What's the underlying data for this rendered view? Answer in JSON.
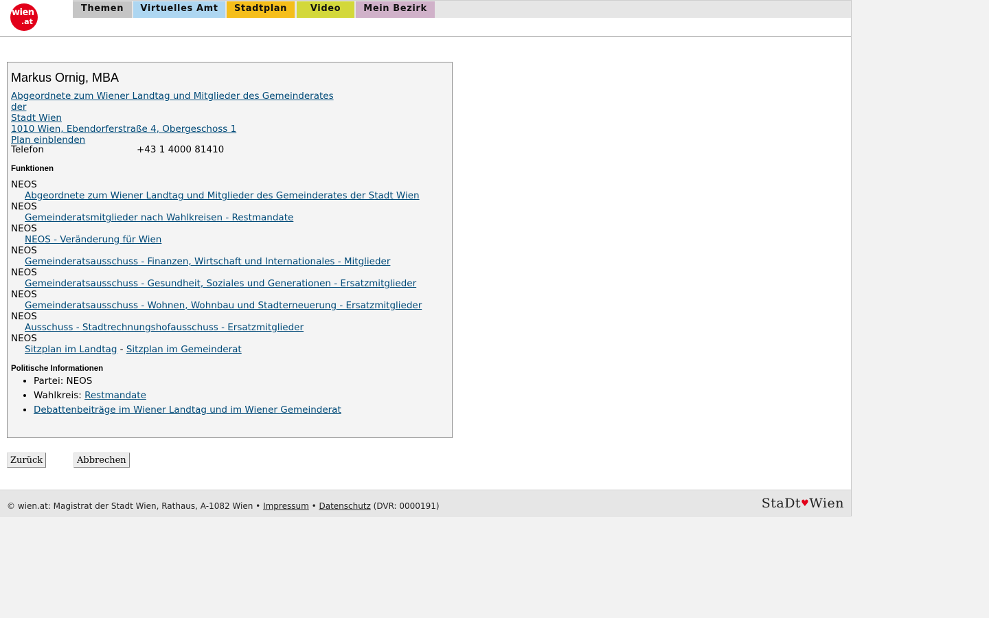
{
  "header": {
    "logo_top": "wien",
    "logo_bottom": ".at",
    "tabs": [
      {
        "label": "Themen"
      },
      {
        "label": "Virtuelles Amt"
      },
      {
        "label": "Stadtplan"
      },
      {
        "label": "Video"
      },
      {
        "label": "Mein Bezirk"
      }
    ]
  },
  "person": {
    "name": "Markus Ornig, MBA",
    "role_link_1": "Abgeordnete zum Wiener Landtag und Mitglieder des Gemeinderates der",
    "role_link_2": "Stadt Wien ",
    "address": "1010 Wien, Ebendorferstraße 4, Obergeschoss 1",
    "plan_link": "Plan einblenden",
    "tel_label": "Telefon",
    "tel_value": "+43 1 4000 81410"
  },
  "funktionen": {
    "title": "Funktionen",
    "items": [
      {
        "party": "NEOS",
        "link": "Abgeordnete zum Wiener Landtag und Mitglieder des Gemeinderates der Stadt Wien"
      },
      {
        "party": "NEOS",
        "link": "Gemeinderatsmitglieder nach Wahlkreisen - Restmandate"
      },
      {
        "party": "NEOS",
        "link": "NEOS - Veränderung für Wien"
      },
      {
        "party": "NEOS",
        "link": "Gemeinderatsausschuss - Finanzen, Wirtschaft und Internationales - Mitglieder"
      },
      {
        "party": "NEOS",
        "link": "Gemeinderatsausschuss - Gesundheit, Soziales und Generationen - Ersatzmitglieder"
      },
      {
        "party": "NEOS",
        "link": "Gemeinderatsausschuss - Wohnen, Wohnbau und Stadterneuerung - Ersatzmitglieder"
      },
      {
        "party": "NEOS",
        "link": "Ausschuss - Stadtrechnungshofausschuss - Ersatzmitglieder"
      }
    ],
    "last_party": "NEOS",
    "sitzplan_landtag": "Sitzplan im Landtag",
    "sitzplan_sep": " - ",
    "sitzplan_gemeinderat": "Sitzplan im Gemeinderat"
  },
  "politisch": {
    "title": "Politische Informationen",
    "partei_label": "Partei: NEOS",
    "wahlkreis_label": "Wahlkreis: ",
    "wahlkreis_link": "Restmandate",
    "debatten_link": "Debattenbeiträge im Wiener Landtag und im Wiener Gemeinderat"
  },
  "buttons": {
    "back": "Zurück",
    "cancel": "Abbrechen"
  },
  "footer": {
    "text_pre": "© wien.at: Magistrat der Stadt Wien, Rathaus, A-1082 Wien • ",
    "impressum": "Impressum",
    "sep": " • ",
    "datenschutz": "Datenschutz",
    "dvr": " (DVR: 0000191)",
    "brand_left": "StaDt",
    "brand_right": "Wien"
  },
  "colors": {
    "link": "#004a78",
    "logo_red": "#e2001a",
    "tab_themen": "#c5c5c5",
    "tab_virtuelles_amt": "#add6f1",
    "tab_stadtplan": "#f5be1b",
    "tab_video": "#d3d83a",
    "tab_mein_bezirk": "#d0b1c9"
  }
}
